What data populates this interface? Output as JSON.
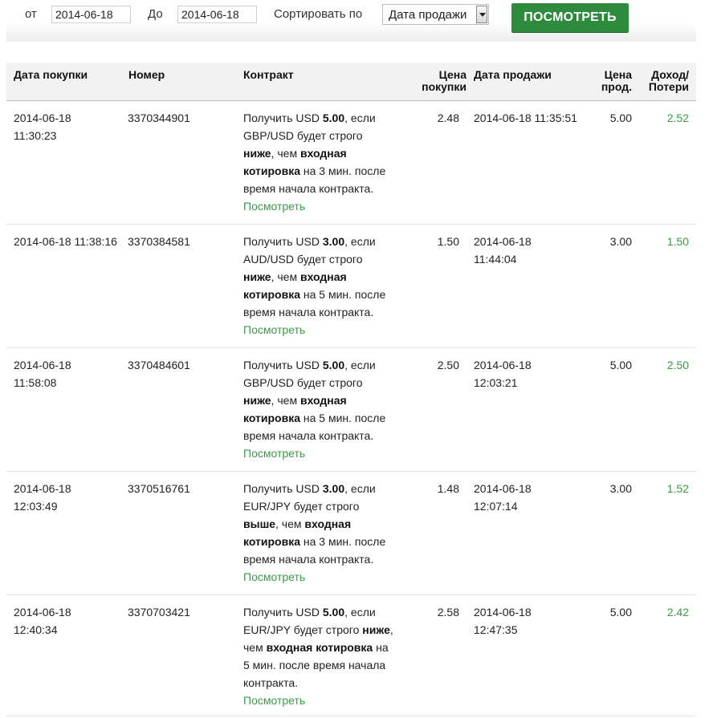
{
  "filter": {
    "from_label": "от",
    "from_value": "2014-06-18",
    "to_label": "До",
    "to_value": "2014-06-18",
    "sort_label": "Сортировать по",
    "sort_value": "Дата продажи",
    "view_button": "ПОСМОТРЕТЬ"
  },
  "colors": {
    "accent": "#2e8b3e",
    "profit": "#3a9a46",
    "header_bg": "#f2f2f2"
  },
  "table": {
    "headers": {
      "purchase_date": "Дата покупки",
      "number": "Номер",
      "contract": "Контракт",
      "purchase_price_1": "Цена",
      "purchase_price_2": "покупки",
      "sale_date": "Дата продажи",
      "sale_price_1": "Цена",
      "sale_price_2": "прод.",
      "profit_1": "Доход/",
      "profit_2": "Потери"
    },
    "view_link": "Посмотреть",
    "rows": [
      {
        "purchase_date_1": "2014-06-18",
        "purchase_date_2": "11:30:23",
        "number": "3370344901",
        "c1": "Получить USD ",
        "c_amount": "5.00",
        "c2": ", если",
        "c3": "GBP/USD будет строго",
        "c_dir": "ниже",
        "c4": ", чем ",
        "c_entry1": "входная",
        "c_entry2": "котировка",
        "c5": " на 3 мин. после",
        "c6": "время начала контракта.",
        "purchase_price": "2.48",
        "sale_date_1": "2014-06-18 11:35:51",
        "sale_date_2": "",
        "sale_price": "5.00",
        "profit": "2.52"
      },
      {
        "purchase_date_1": "2014-06-18 11:38:16",
        "purchase_date_2": "",
        "number": "3370384581",
        "c1": "Получить USD ",
        "c_amount": "3.00",
        "c2": ", если",
        "c3": "AUD/USD будет строго",
        "c_dir": "ниже",
        "c4": ", чем ",
        "c_entry1": "входная",
        "c_entry2": "котировка",
        "c5": " на 5 мин. после",
        "c6": "время начала контракта.",
        "purchase_price": "1.50",
        "sale_date_1": "2014-06-18",
        "sale_date_2": "11:44:04",
        "sale_price": "3.00",
        "profit": "1.50"
      },
      {
        "purchase_date_1": "2014-06-18",
        "purchase_date_2": "11:58:08",
        "number": "3370484601",
        "c1": "Получить USD ",
        "c_amount": "5.00",
        "c2": ", если",
        "c3": "GBP/USD будет строго",
        "c_dir": "ниже",
        "c4": ", чем ",
        "c_entry1": "входная",
        "c_entry2": "котировка",
        "c5": " на 5 мин. после",
        "c6": "время начала контракта.",
        "purchase_price": "2.50",
        "sale_date_1": "2014-06-18",
        "sale_date_2": "12:03:21",
        "sale_price": "5.00",
        "profit": "2.50"
      },
      {
        "purchase_date_1": "2014-06-18",
        "purchase_date_2": "12:03:49",
        "number": "3370516761",
        "c1": "Получить USD ",
        "c_amount": "3.00",
        "c2": ", если",
        "c3": "EUR/JPY будет строго",
        "c_dir": "выше",
        "c4": ", чем ",
        "c_entry1": "входная",
        "c_entry2": "котировка",
        "c5": " на 3 мин. после",
        "c6": "время начала контракта.",
        "purchase_price": "1.48",
        "sale_date_1": "2014-06-18",
        "sale_date_2": "12:07:14",
        "sale_price": "3.00",
        "profit": "1.52"
      },
      {
        "purchase_date_1": "2014-06-18",
        "purchase_date_2": "12:40:34",
        "number": "3370703421",
        "l1a": "Получить USD ",
        "l1b": "5.00",
        "l1c": ", если",
        "l2a": "EUR/JPY будет строго ",
        "l2b": "ниже",
        "l2c": ",",
        "l3a": "чем ",
        "l3b": "входная котировка",
        "l3c": " на",
        "l4": "5 мин. после время начала",
        "l5": "контракта.",
        "purchase_price": "2.58",
        "sale_date_1": "2014-06-18",
        "sale_date_2": "12:47:35",
        "sale_price": "5.00",
        "profit": "2.42"
      }
    ]
  }
}
